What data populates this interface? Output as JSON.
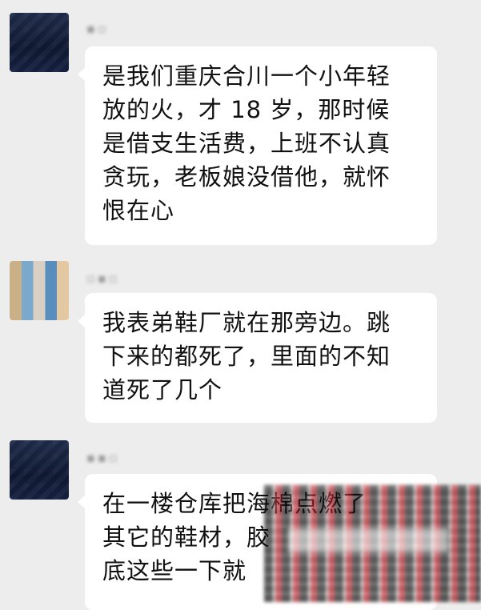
{
  "messages": [
    {
      "lines": [
        "是我们重庆合川一个小年轻",
        "放的火，才 18 岁，那时候",
        "是借支生活费，上班不认真",
        "贪玩，老板娘没借他，就怀",
        "恨在心"
      ]
    },
    {
      "lines": [
        "我表弟鞋厂就在那旁边。跳",
        "下来的都死了，里面的不知",
        "道死了几个"
      ]
    },
    {
      "lines": [
        "在一楼仓库把海棉点燃了",
        "其它的鞋材，胶",
        "底这些一下就"
      ]
    }
  ],
  "colors": {
    "background": "#ededed",
    "bubble": "#ffffff",
    "text": "#111111"
  },
  "icons": {
    "avatar_1": "dark-night-avatar",
    "avatar_2": "colorful-mosaic-avatar",
    "avatar_3": "dark-night-avatar"
  }
}
